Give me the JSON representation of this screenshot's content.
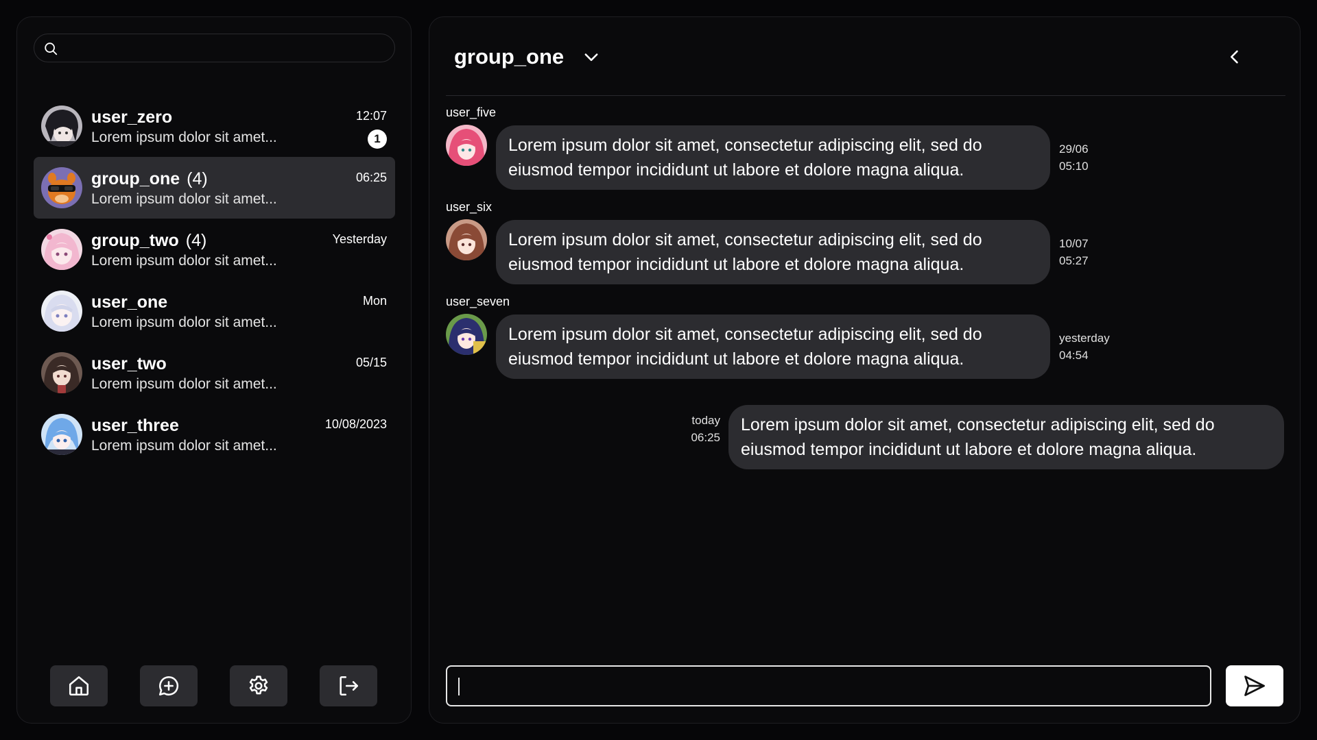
{
  "search": {
    "placeholder": ""
  },
  "conversations": [
    {
      "name": "user_zero",
      "count": "",
      "preview": "Lorem ipsum dolor sit amet...",
      "time": "12:07",
      "unread": "1",
      "active": false
    },
    {
      "name": "group_one",
      "count": "(4)",
      "preview": "Lorem ipsum dolor sit amet...",
      "time": "06:25",
      "unread": "",
      "active": true
    },
    {
      "name": "group_two",
      "count": "(4)",
      "preview": "Lorem ipsum dolor sit amet...",
      "time": "Yesterday",
      "unread": "",
      "active": false
    },
    {
      "name": "user_one",
      "count": "",
      "preview": "Lorem ipsum dolor sit amet...",
      "time": "Mon",
      "unread": "",
      "active": false
    },
    {
      "name": "user_two",
      "count": "",
      "preview": "Lorem ipsum dolor sit amet...",
      "time": "05/15",
      "unread": "",
      "active": false
    },
    {
      "name": "user_three",
      "count": "",
      "preview": "Lorem ipsum dolor sit amet...",
      "time": "10/08/2023",
      "unread": "",
      "active": false
    }
  ],
  "nav": [
    {
      "icon": "home-icon"
    },
    {
      "icon": "new-chat-icon"
    },
    {
      "icon": "gear-icon"
    },
    {
      "icon": "logout-icon"
    }
  ],
  "chat": {
    "title": "group_one",
    "dropdown_icon": "chevron-down-icon",
    "back_icon": "chevron-left-icon",
    "messages": [
      {
        "sender": "user_five",
        "text": "Lorem ipsum dolor sit amet, consectetur adipiscing elit, sed do eiusmod tempor incididunt ut labore et dolore magna aliqua.",
        "time_line1": "29/06",
        "time_line2": "05:10",
        "direction": "in"
      },
      {
        "sender": "user_six",
        "text": "Lorem ipsum dolor sit amet, consectetur adipiscing elit, sed do eiusmod tempor incididunt ut labore et dolore magna aliqua.",
        "time_line1": "10/07",
        "time_line2": "05:27",
        "direction": "in"
      },
      {
        "sender": "user_seven",
        "text": "Lorem ipsum dolor sit amet, consectetur adipiscing elit, sed do eiusmod tempor incididunt ut labore et dolore magna aliqua.",
        "time_line1": "yesterday",
        "time_line2": "04:54",
        "direction": "in"
      },
      {
        "sender": "",
        "text": "Lorem ipsum dolor sit amet, consectetur adipiscing elit, sed do eiusmod tempor incididunt ut labore et dolore magna aliqua.",
        "time_line1": "today",
        "time_line2": "06:25",
        "direction": "out"
      }
    ],
    "composer": {
      "value": "",
      "placeholder": ""
    },
    "send_icon": "send-icon"
  },
  "colors": {
    "background": "#060608",
    "panel": "#0a0a0c",
    "bubble": "#2c2c30",
    "active_row": "#2c2c30",
    "text": "#ffffff"
  }
}
